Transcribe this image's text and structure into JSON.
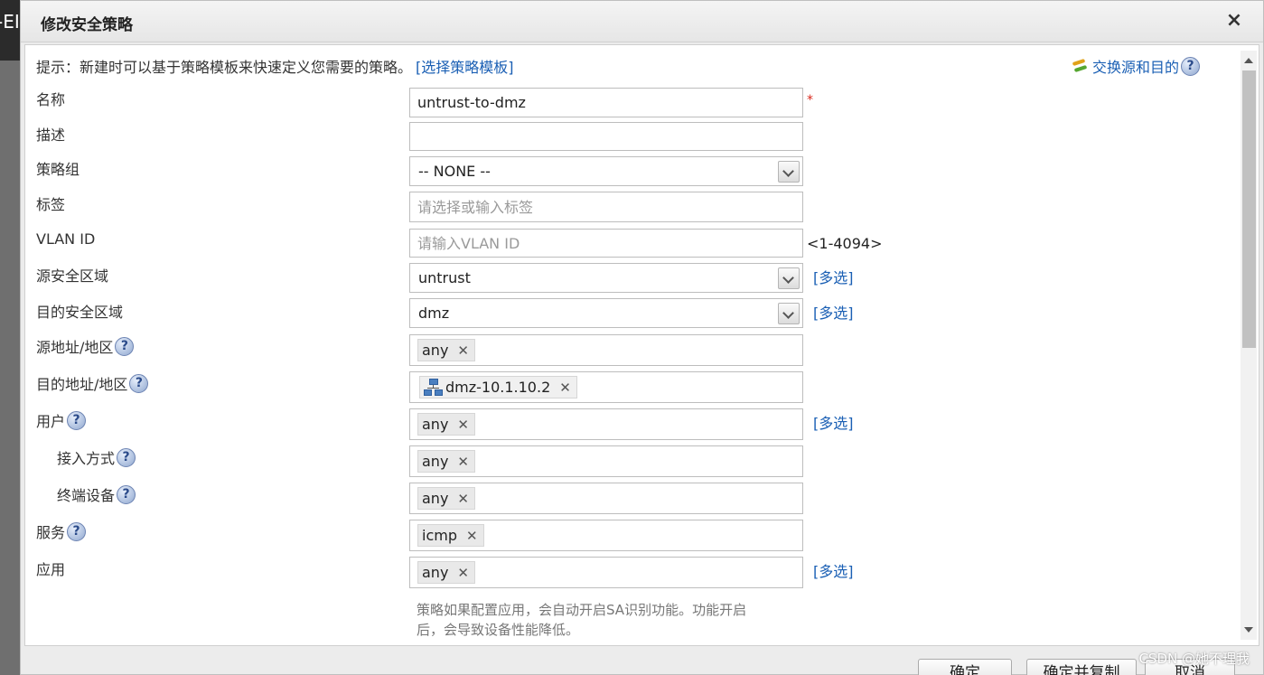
{
  "background": {
    "peek_text": "-EI"
  },
  "dialog": {
    "title": "修改安全策略",
    "close_glyph": "×"
  },
  "hint": {
    "text": "提示：新建时可以基于策略模板来快速定义您需要的策略。",
    "link": "[选择策略模板]",
    "swap_label": "交换源和目的"
  },
  "form": {
    "name": {
      "label": "名称",
      "value": "untrust-to-dmz",
      "required_mark": "*"
    },
    "description": {
      "label": "描述",
      "value": ""
    },
    "policy_group": {
      "label": "策略组",
      "selected": "-- NONE --"
    },
    "tag": {
      "label": "标签",
      "placeholder": "请选择或输入标签"
    },
    "vlan_id": {
      "label": "VLAN ID",
      "placeholder": "请输入VLAN ID",
      "range": "<1-4094>"
    },
    "source_zone": {
      "label": "源安全区域",
      "selected": "untrust",
      "multi": "[多选]"
    },
    "dest_zone": {
      "label": "目的安全区域",
      "selected": "dmz",
      "multi": "[多选]"
    },
    "source_address": {
      "label": "源地址/地区",
      "tag": "any"
    },
    "dest_address": {
      "label": "目的地址/地区",
      "tag": "dmz-10.1.10.2"
    },
    "user": {
      "label": "用户",
      "tag": "any",
      "multi": "[多选]"
    },
    "access_method": {
      "label": "接入方式",
      "tag": "any"
    },
    "terminal_device": {
      "label": "终端设备",
      "tag": "any"
    },
    "service": {
      "label": "服务",
      "tag": "icmp"
    },
    "application": {
      "label": "应用",
      "tag": "any",
      "multi": "[多选]"
    },
    "app_note_line1": "策略如果配置应用，会自动开启SA识别功能。功能开启",
    "app_note_line2": "后，会导致设备性能降低。"
  },
  "icons": {
    "help": "?",
    "tag_remove": "✕"
  },
  "footer": {
    "ok_label": "确定",
    "ok_copy_label": "确定并复制",
    "cancel_label": "取消"
  },
  "watermark": "CSDN @她不理我",
  "colors": {
    "link": "#1a5fb4",
    "required": "#d9281c"
  }
}
